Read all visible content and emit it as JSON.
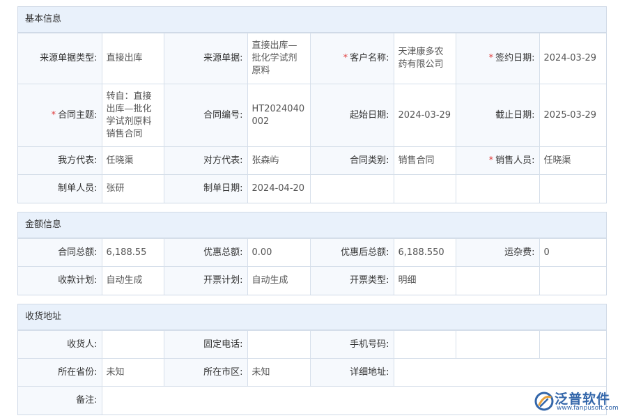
{
  "basic": {
    "title": "基本信息",
    "source_type_label": "来源单据类型:",
    "source_type_value": "直接出库",
    "source_doc_label": "来源单据:",
    "source_doc_value": "直接出库—批化学试剂原料",
    "customer_label": "客户名称:",
    "customer_value": "天津康多农药有限公司",
    "sign_date_label": "签约日期:",
    "sign_date_value": "2024-03-29",
    "subject_label": "合同主题:",
    "subject_value": "转自：直接出库—批化学试剂原料销售合同",
    "contract_no_label": "合同编号:",
    "contract_no_value": "HT2024040002",
    "start_date_label": "起始日期:",
    "start_date_value": "2024-03-29",
    "end_date_label": "截止日期:",
    "end_date_value": "2025-03-29",
    "our_rep_label": "我方代表:",
    "our_rep_value": "任晓渠",
    "other_rep_label": "对方代表:",
    "other_rep_value": "张森屿",
    "contract_type_label": "合同类别:",
    "contract_type_value": "销售合同",
    "sales_label": "销售人员:",
    "sales_value": "任晓渠",
    "maker_label": "制单人员:",
    "maker_value": "张研",
    "make_date_label": "制单日期:",
    "make_date_value": "2024-04-20"
  },
  "amount": {
    "title": "金额信息",
    "total_label": "合同总额:",
    "total_value": "6,188.55",
    "discount_label": "优惠总额:",
    "discount_value": "0.00",
    "after_label": "优惠后总额:",
    "after_value": "6,188.550",
    "freight_label": "运杂费:",
    "freight_value": "0",
    "receipt_plan_label": "收款计划:",
    "receipt_plan_value": "自动生成",
    "invoice_plan_label": "开票计划:",
    "invoice_plan_value": "自动生成",
    "invoice_type_label": "开票类型:",
    "invoice_type_value": "明细"
  },
  "address": {
    "title": "收货地址",
    "receiver_label": "收货人:",
    "receiver_value": "",
    "phone_label": "固定电话:",
    "phone_value": "",
    "mobile_label": "手机号码:",
    "mobile_value": "",
    "province_label": "所在省份:",
    "province_value": "未知",
    "city_label": "所在市区:",
    "city_value": "未知",
    "detail_label": "详细地址:",
    "detail_value": "",
    "remark_label": "备注:",
    "remark_value": ""
  },
  "logo": {
    "name": "泛普软件",
    "url": "www.fanpusoft.com",
    "color": "#3366aa"
  }
}
